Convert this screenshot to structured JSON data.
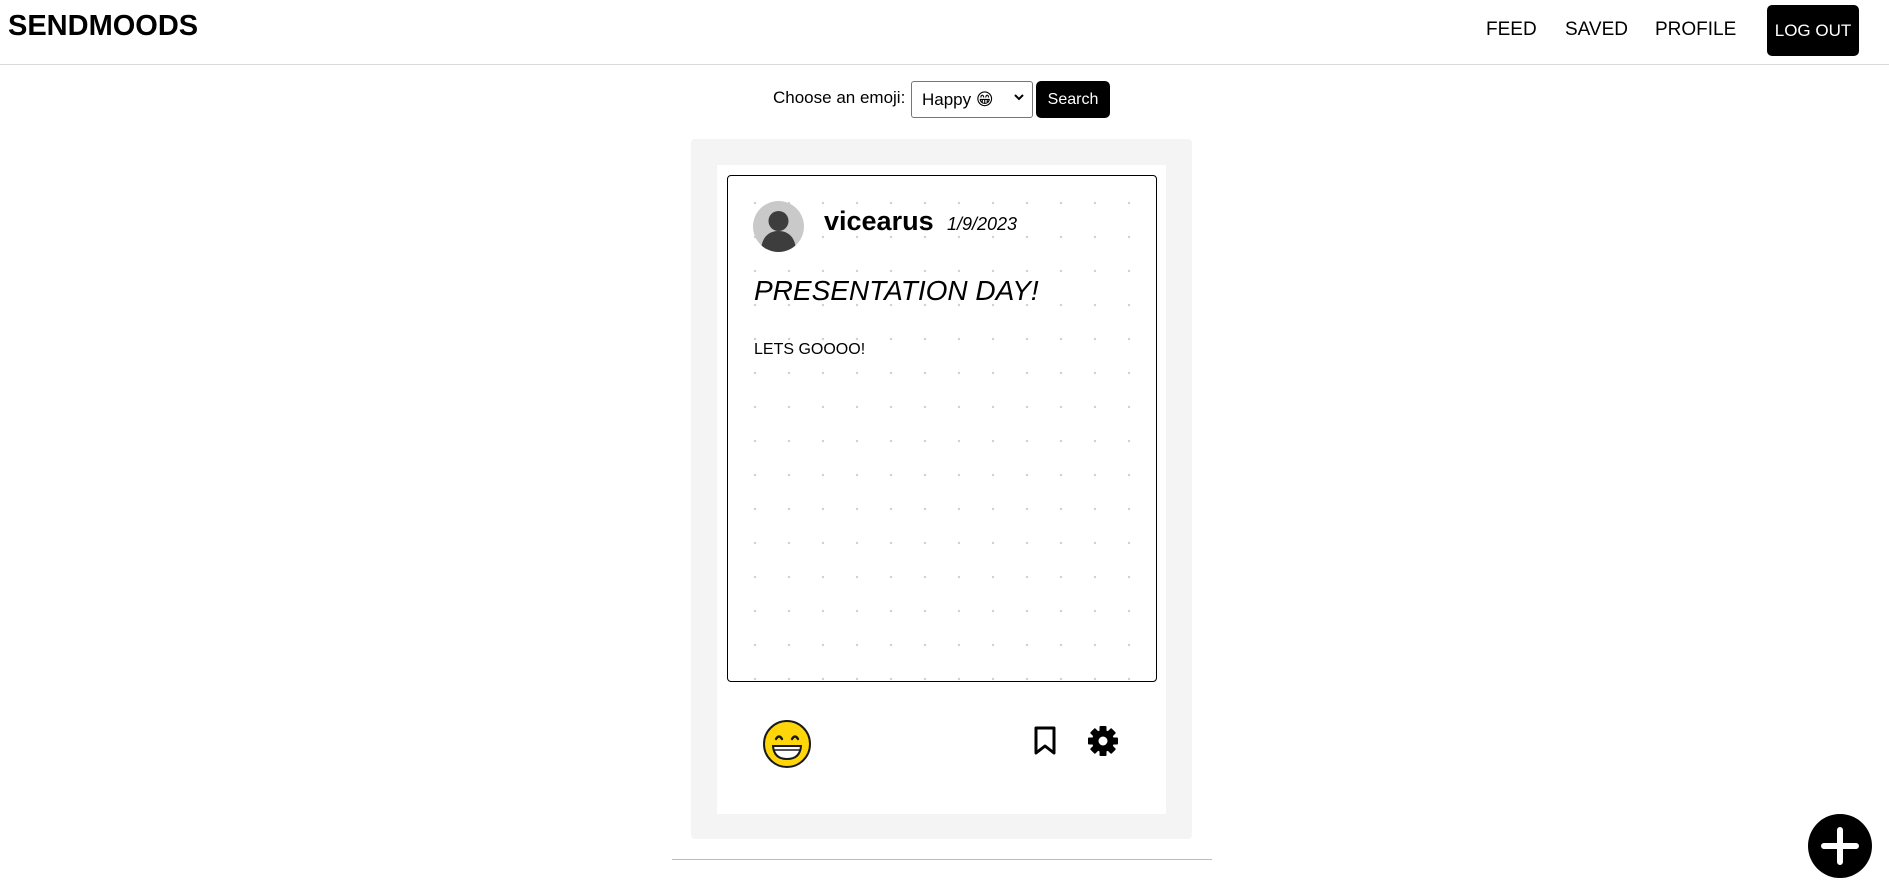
{
  "header": {
    "brand": "SENDMOODS",
    "nav": {
      "feed": "FEED",
      "saved": "SAVED",
      "profile": "PROFILE"
    },
    "logout_label": "LOG OUT"
  },
  "filter": {
    "label": "Choose an emoji:",
    "selected_value": "Happy 😁",
    "search_label": "Search"
  },
  "post": {
    "username": "vicearus",
    "date": "1/9/2023",
    "title": "PRESENTATION DAY!",
    "body": "LETS GOOOO!",
    "mood_icon": "grinning-face-icon",
    "actions": [
      "bookmark-icon",
      "gear-icon"
    ]
  },
  "fab": {
    "icon": "plus-icon"
  },
  "colors": {
    "primary": "#000000",
    "card_background": "#f4f4f4",
    "emoji_yellow": "#ffd60a"
  }
}
